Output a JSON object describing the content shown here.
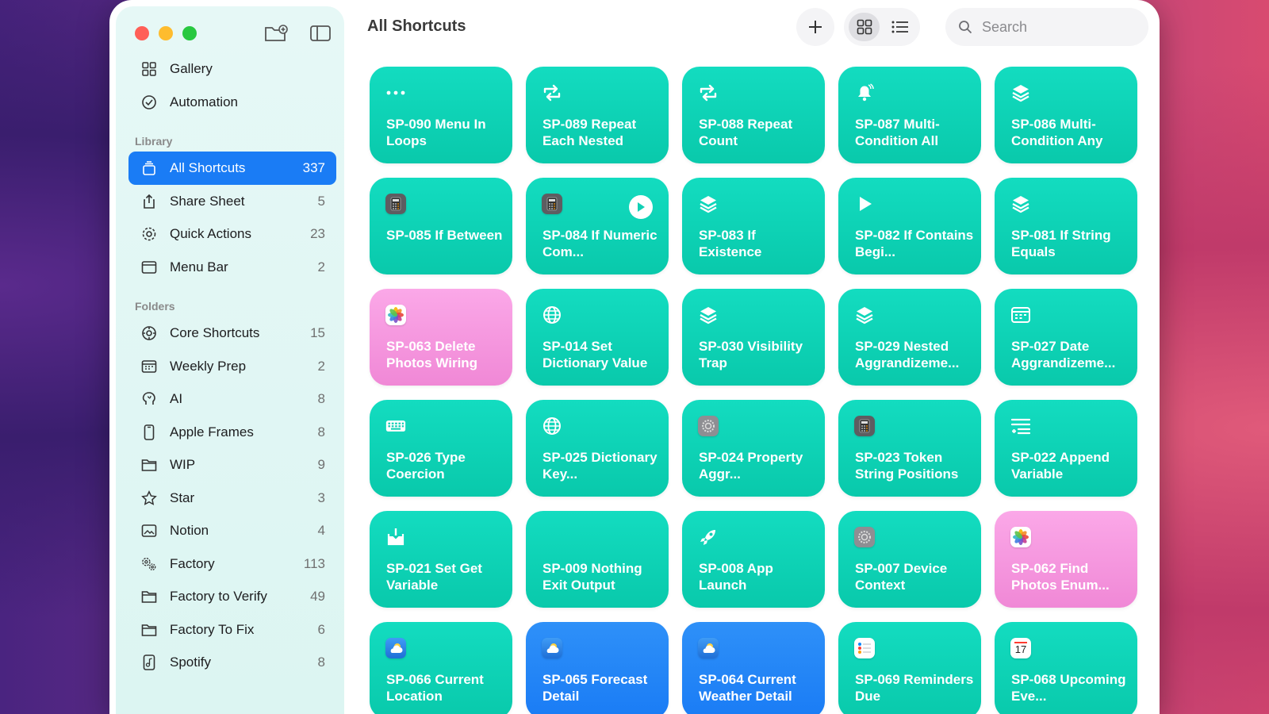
{
  "window": {
    "title": "All Shortcuts"
  },
  "sidebar": {
    "top_items": [
      {
        "label": "Gallery",
        "icon": "grid-icon"
      },
      {
        "label": "Automation",
        "icon": "clock-check-icon"
      }
    ],
    "library_header": "Library",
    "library": [
      {
        "label": "All Shortcuts",
        "count": "337",
        "icon": "stack-icon",
        "active": true
      },
      {
        "label": "Share Sheet",
        "count": "5",
        "icon": "share-icon"
      },
      {
        "label": "Quick Actions",
        "count": "23",
        "icon": "gear-icon"
      },
      {
        "label": "Menu Bar",
        "count": "2",
        "icon": "window-icon"
      }
    ],
    "folders_header": "Folders",
    "folders": [
      {
        "label": "Core Shortcuts",
        "count": "15",
        "icon": "gear-badge-icon"
      },
      {
        "label": "Weekly Prep",
        "count": "2",
        "icon": "calendar-icon"
      },
      {
        "label": "AI",
        "count": "8",
        "icon": "brain-icon"
      },
      {
        "label": "Apple Frames",
        "count": "8",
        "icon": "phone-icon"
      },
      {
        "label": "WIP",
        "count": "9",
        "icon": "folder-icon"
      },
      {
        "label": "Star",
        "count": "3",
        "icon": "star-icon"
      },
      {
        "label": "Notion",
        "count": "4",
        "icon": "photo-icon"
      },
      {
        "label": "Factory",
        "count": "113",
        "icon": "gears-icon"
      },
      {
        "label": "Factory to Verify",
        "count": "49",
        "icon": "folder-icon"
      },
      {
        "label": "Factory To Fix",
        "count": "6",
        "icon": "folder-icon"
      },
      {
        "label": "Spotify",
        "count": "8",
        "icon": "music-icon"
      }
    ]
  },
  "toolbar": {
    "add_label": "+",
    "search_placeholder": "Search"
  },
  "shortcuts": [
    {
      "name": "SP-090 Menu In Loops",
      "color": "teal",
      "icon": "ellipsis-icon"
    },
    {
      "name": "SP-089 Repeat Each Nested",
      "color": "teal",
      "icon": "repeat-icon"
    },
    {
      "name": "SP-088 Repeat Count",
      "color": "teal",
      "icon": "repeat-icon"
    },
    {
      "name": "SP-087 Multi-Condition All",
      "color": "teal",
      "icon": "bell-icon"
    },
    {
      "name": "SP-086 Multi-Condition Any",
      "color": "teal",
      "icon": "layers-icon"
    },
    {
      "name": "SP-085 If Between",
      "color": "teal",
      "icon": "calculator-icon"
    },
    {
      "name": "SP-084 If Numeric Com...",
      "color": "teal",
      "icon": "calculator-icon",
      "play": true
    },
    {
      "name": "SP-083 If Existence",
      "color": "teal",
      "icon": "layers-icon"
    },
    {
      "name": "SP-082 If Contains Begi...",
      "color": "teal",
      "icon": "play-icon"
    },
    {
      "name": "SP-081 If String Equals",
      "color": "teal",
      "icon": "layers-icon"
    },
    {
      "name": "SP-063 Delete Photos Wiring",
      "color": "pink",
      "icon": "photos-icon"
    },
    {
      "name": "SP-014 Set Dictionary Value",
      "color": "teal",
      "icon": "globe-icon"
    },
    {
      "name": "SP-030 Visibility Trap",
      "color": "teal",
      "icon": "layers-icon"
    },
    {
      "name": "SP-029 Nested Aggrandizeme...",
      "color": "teal",
      "icon": "layers-icon"
    },
    {
      "name": "SP-027 Date Aggrandizeme...",
      "color": "teal",
      "icon": "calendar-icon"
    },
    {
      "name": "SP-026 Type Coercion",
      "color": "teal",
      "icon": "keyboard-icon"
    },
    {
      "name": "SP-025 Dictionary Key...",
      "color": "teal",
      "icon": "globe-icon"
    },
    {
      "name": "SP-024 Property Aggr...",
      "color": "teal",
      "icon": "settings-app-icon"
    },
    {
      "name": "SP-023 Token String Positions",
      "color": "teal",
      "icon": "calculator-icon"
    },
    {
      "name": "SP-022 Append Variable",
      "color": "teal",
      "icon": "list-add-icon"
    },
    {
      "name": "SP-021 Set Get Variable",
      "color": "teal",
      "icon": "download-icon"
    },
    {
      "name": "SP-009 Nothing Exit Output",
      "color": "teal",
      "icon": ""
    },
    {
      "name": "SP-008 App Launch",
      "color": "teal",
      "icon": "rocket-icon"
    },
    {
      "name": "SP-007 Device Context",
      "color": "teal",
      "icon": "settings-app-icon"
    },
    {
      "name": "SP-062 Find Photos Enum...",
      "color": "pink",
      "icon": "photos-icon"
    },
    {
      "name": "SP-066 Current Location",
      "color": "teal",
      "icon": "weather-icon"
    },
    {
      "name": "SP-065 Forecast Detail",
      "color": "blue",
      "icon": "weather-icon"
    },
    {
      "name": "SP-064 Current Weather Detail",
      "color": "blue",
      "icon": "weather-icon"
    },
    {
      "name": "SP-069 Reminders Due",
      "color": "teal",
      "icon": "reminders-icon"
    },
    {
      "name": "SP-068 Upcoming Eve...",
      "color": "teal",
      "icon": "calendar-app-icon",
      "icon_text": "17"
    }
  ],
  "colors": {
    "teal": "#0fd3b8",
    "pink": "#f79ae0",
    "blue": "#2286f6",
    "accent": "#1a7cf5"
  }
}
